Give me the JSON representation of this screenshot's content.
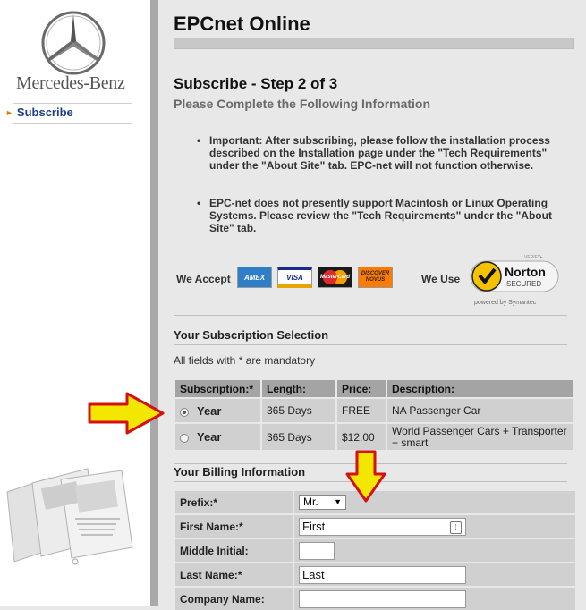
{
  "sidebar": {
    "brand": "Mercedes-Benz",
    "nav": [
      {
        "label": "Subscribe",
        "active": true
      }
    ]
  },
  "header": {
    "title": "EPCnet Online",
    "step": "Subscribe - Step 2 of 3",
    "subtitle": "Please Complete the Following Information"
  },
  "notes": [
    "Important: After subscribing, please follow the installation process described on the Installation page under the \"Tech Requirements\" under the \"About Site\" tab. EPC-net will not function otherwise.",
    "EPC-net does not presently support Macintosh or Linux Operating Systems. Please review the \"Tech Requirements\" under the \"About Site\" tab."
  ],
  "payment": {
    "accept_label": "We Accept",
    "cards": [
      "AMEX",
      "VISA",
      "MasterCard",
      "DISCOVER NOVUS"
    ],
    "use_label": "We Use",
    "seal": {
      "verify": "VERIFY▸",
      "name": "Norton",
      "secured": "SECURED",
      "powered": "powered by Symantec"
    }
  },
  "subscription": {
    "heading": "Your Subscription Selection",
    "mandatory_note": "All fields with * are mandatory",
    "columns": [
      "Subscription:*",
      "Length:",
      "Price:",
      "Description:"
    ],
    "rows": [
      {
        "label": "Year",
        "selected": true,
        "length": "365 Days",
        "price": "FREE",
        "description": "NA Passenger Car"
      },
      {
        "label": "Year",
        "selected": false,
        "length": "365 Days",
        "price": "$12.00",
        "description": "World Passenger Cars + Transporter + smart"
      }
    ]
  },
  "billing": {
    "heading": "Your Billing Information",
    "prefix_label": "Prefix:*",
    "prefix_value": "Mr.",
    "first_label": "First Name:*",
    "first_value": "First",
    "middle_label": "Middle Initial:",
    "middle_value": "",
    "last_label": "Last Name:*",
    "last_value": "Last",
    "company_label": "Company Name:",
    "company_value": ""
  },
  "colors": {
    "accent": "#1b3f8c",
    "arrow_fill": "#f3e600",
    "arrow_stroke": "#d41010"
  }
}
